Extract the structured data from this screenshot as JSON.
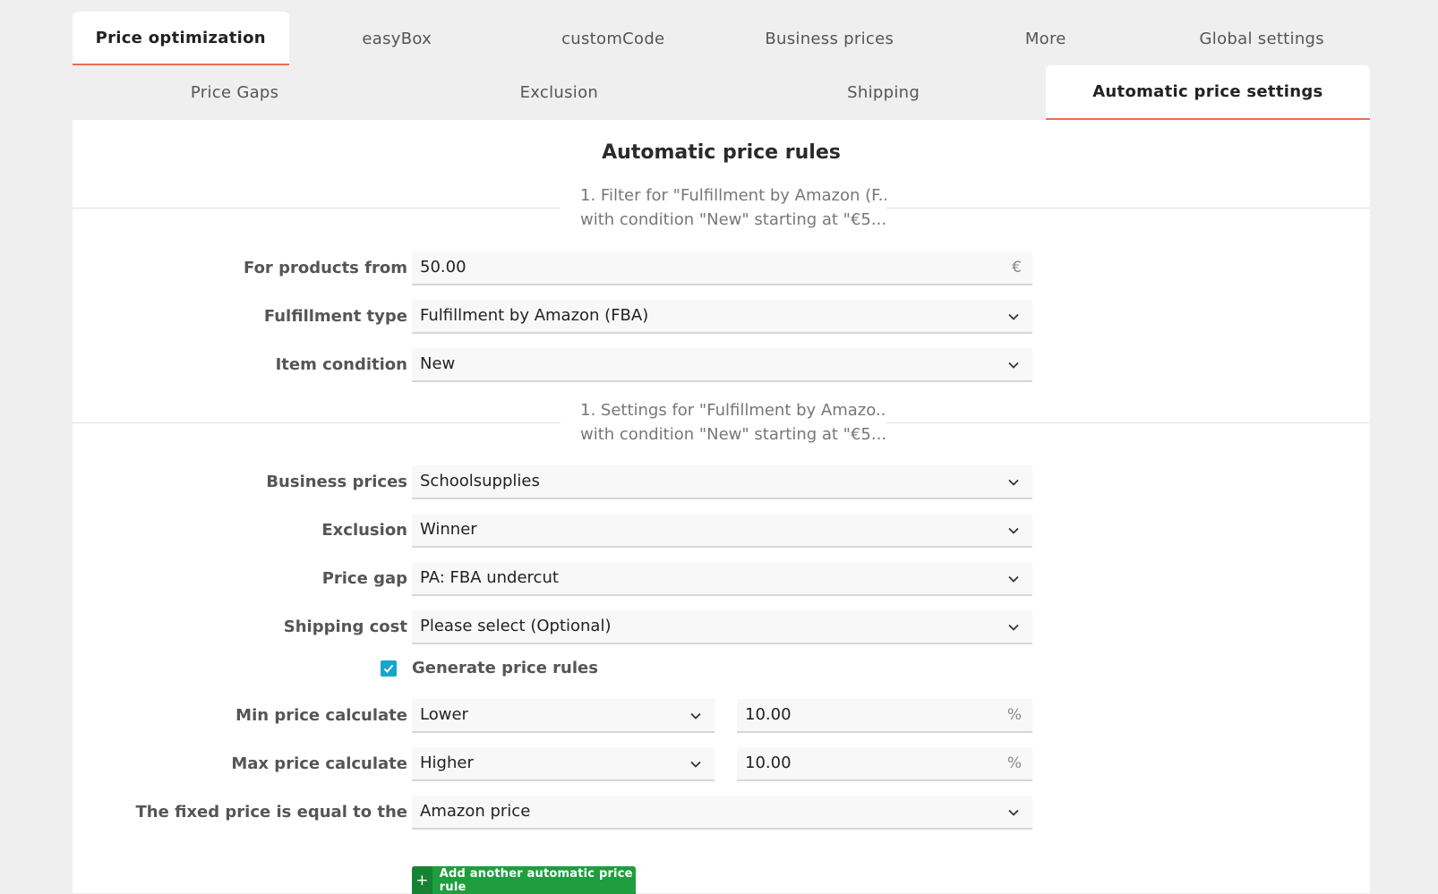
{
  "main_tabs": [
    {
      "label": "Price optimization",
      "active": true
    },
    {
      "label": "easyBox",
      "active": false
    },
    {
      "label": "customCode",
      "active": false
    },
    {
      "label": "Business prices",
      "active": false
    },
    {
      "label": "More",
      "active": false
    },
    {
      "label": "Global settings",
      "active": false
    }
  ],
  "sub_tabs": [
    {
      "label": "Price Gaps",
      "active": false
    },
    {
      "label": "Exclusion",
      "active": false
    },
    {
      "label": "Shipping",
      "active": false
    },
    {
      "label": "Automatic price settings",
      "active": true
    }
  ],
  "page_title": "Automatic price rules",
  "filter_section": {
    "line1": "1. Filter for \"Fulfillment by Amazon (F...",
    "line2": "with condition \"New\" starting at \"€5..."
  },
  "filter_fields": {
    "products_from": {
      "label": "For products from",
      "value": "50.00",
      "suffix": "€"
    },
    "fulfillment_type": {
      "label": "Fulfillment type",
      "value": "Fulfillment by Amazon (FBA)"
    },
    "item_condition": {
      "label": "Item condition",
      "value": "New"
    }
  },
  "settings_section": {
    "line1": "1. Settings for \"Fulfillment by Amazo...",
    "line2": "with condition \"New\" starting at \"€5..."
  },
  "settings_fields": {
    "business_prices": {
      "label": "Business prices",
      "value": "Schoolsupplies"
    },
    "exclusion": {
      "label": "Exclusion",
      "value": "Winner"
    },
    "price_gap": {
      "label": "Price gap",
      "value": "PA: FBA undercut"
    },
    "shipping_cost": {
      "label": "Shipping cost",
      "value": "Please select (Optional)"
    }
  },
  "generate_rules": {
    "label": "Generate price rules",
    "checked": true
  },
  "min_price": {
    "label": "Min price calculate",
    "mode": "Lower",
    "value": "10.00",
    "suffix": "%"
  },
  "max_price": {
    "label": "Max price calculate",
    "mode": "Higher",
    "value": "10.00",
    "suffix": "%"
  },
  "fixed_price": {
    "label": "The fixed price is equal to the",
    "value": "Amazon price"
  },
  "add_button": {
    "label": "Add another automatic price rule",
    "icon": "plus-icon"
  },
  "colors": {
    "accent": "#f26b4f",
    "checkbox": "#18a7c8",
    "button": "#1e9e3f"
  }
}
